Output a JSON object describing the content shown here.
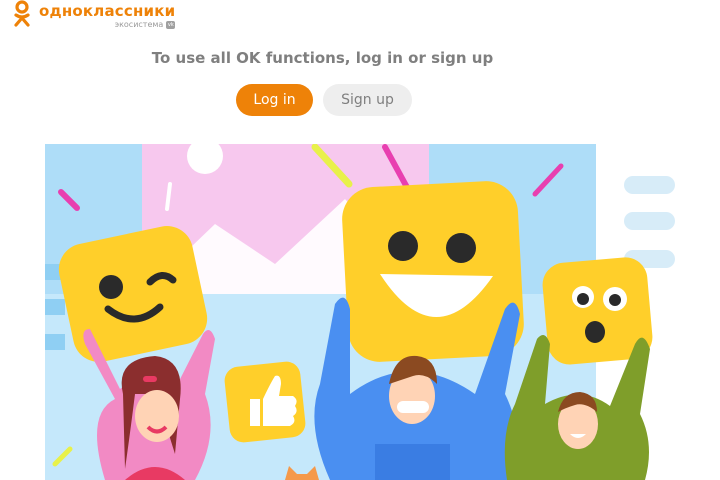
{
  "header": {
    "logo_name": "одноклассники",
    "logo_sub": "экосистема",
    "vk_badge": "vk"
  },
  "auth_prompt": {
    "headline": "To use all OK functions, log in or sign up",
    "login_label": "Log in",
    "signup_label": "Sign up"
  },
  "colors": {
    "brand_orange": "#ee8208",
    "text_grey": "#7f7f7f",
    "button_grey": "#eeeeee"
  },
  "illustration": {
    "subject": "people-holding-emoji-signs",
    "icons": [
      "winking-emoji-icon",
      "laughing-emoji-icon",
      "surprised-emoji-icon",
      "thumbs-up-icon"
    ]
  }
}
